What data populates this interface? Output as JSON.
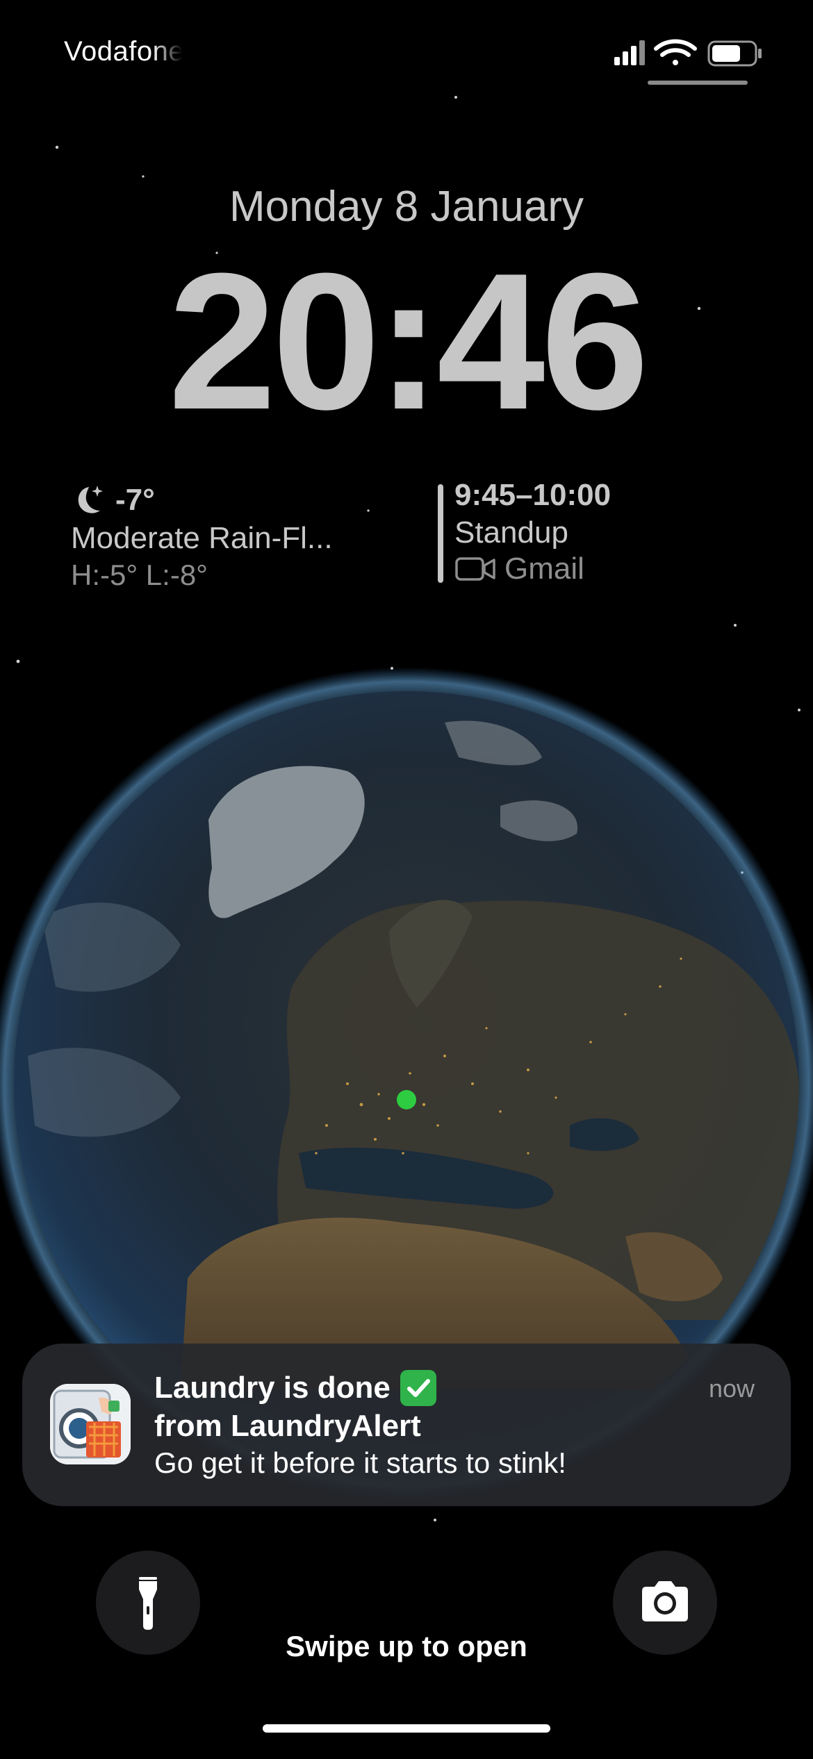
{
  "status_bar": {
    "carrier": "Vodafone",
    "icons": [
      "signal-icon",
      "wifi-icon",
      "battery-icon"
    ],
    "battery_level": 0.7
  },
  "lock_screen": {
    "date": "Monday 8 January",
    "time": "20:46"
  },
  "weather_widget": {
    "icon": "moon-stars-icon",
    "temperature": "-7°",
    "condition": "Moderate Rain-Fl...",
    "high_low": "H:-5° L:-8°"
  },
  "calendar_widget": {
    "time_range": "9:45–10:00",
    "title": "Standup",
    "source_icon": "video-camera-icon",
    "source": "Gmail"
  },
  "notification": {
    "app_icon": "laundry-app-icon",
    "title": "Laundry is done",
    "title_emoji": "check-mark-emoji",
    "subtitle": "from LaundryAlert",
    "body": "Go get it before it starts to stink!",
    "time": "now"
  },
  "controls": {
    "left_button_icon": "flashlight-icon",
    "right_button_icon": "camera-icon",
    "swipe_hint": "Swipe up to open"
  },
  "colors": {
    "location_dot": "#2ecc40",
    "notification_bg": "#26282c"
  }
}
